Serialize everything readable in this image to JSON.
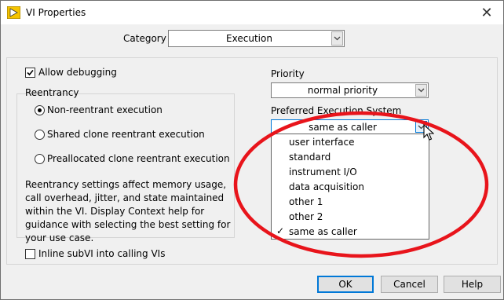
{
  "window": {
    "title": "VI Properties"
  },
  "category": {
    "label": "Category",
    "value": "Execution"
  },
  "allow_debugging": {
    "label": "Allow debugging",
    "checked": true
  },
  "reentrancy": {
    "title": "Reentrancy",
    "options": [
      {
        "label": "Non-reentrant execution",
        "selected": true
      },
      {
        "label": "Shared clone reentrant execution",
        "selected": false
      },
      {
        "label": "Preallocated clone reentrant execution",
        "selected": false
      }
    ],
    "description": "Reentrancy settings affect memory usage, call overhead, jitter, and state maintained within the VI. Display Context help for guidance with selecting the best setting for your use case."
  },
  "inline_subvi": {
    "label": "Inline subVI into calling VIs",
    "checked": false
  },
  "priority": {
    "label": "Priority",
    "value": "normal priority"
  },
  "execution_system": {
    "label": "Preferred Execution System",
    "value": "same as caller",
    "options": [
      {
        "label": "user interface",
        "checked": false
      },
      {
        "label": "standard",
        "checked": false
      },
      {
        "label": "instrument I/O",
        "checked": false
      },
      {
        "label": "data acquisition",
        "checked": false
      },
      {
        "label": "other 1",
        "checked": false
      },
      {
        "label": "other 2",
        "checked": false
      },
      {
        "label": "same as caller",
        "checked": true
      }
    ]
  },
  "buttons": {
    "ok": "OK",
    "cancel": "Cancel",
    "help": "Help"
  },
  "colors": {
    "annotation": "#e8141b",
    "focus": "#0078d7"
  }
}
